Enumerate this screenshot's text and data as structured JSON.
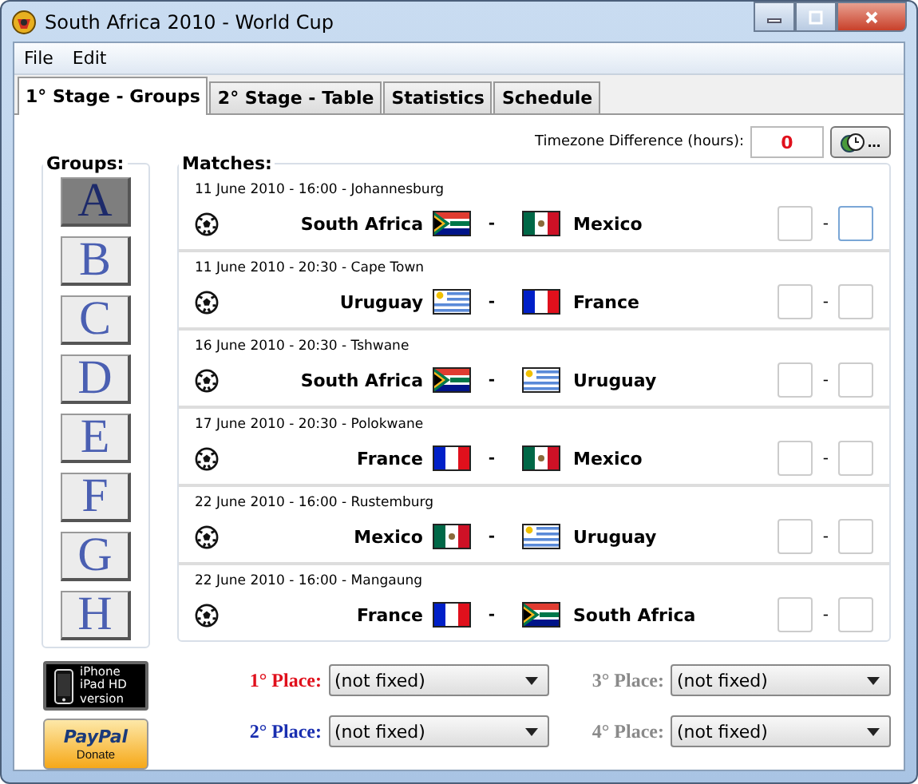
{
  "window": {
    "title": "South Africa 2010 - World Cup"
  },
  "menu": [
    "File",
    "Edit"
  ],
  "tabs": [
    {
      "label": "1° Stage - Groups",
      "selected": true
    },
    {
      "label": "2° Stage - Table",
      "selected": false
    },
    {
      "label": "Statistics",
      "selected": false
    },
    {
      "label": "Schedule",
      "selected": false
    }
  ],
  "timezone": {
    "label": "Timezone Difference (hours):",
    "value": "0",
    "button": "..."
  },
  "groups": {
    "title": "Groups:",
    "items": [
      {
        "label": "A",
        "selected": true
      },
      {
        "label": "B",
        "selected": false
      },
      {
        "label": "C",
        "selected": false
      },
      {
        "label": "D",
        "selected": false
      },
      {
        "label": "E",
        "selected": false
      },
      {
        "label": "F",
        "selected": false
      },
      {
        "label": "G",
        "selected": false
      },
      {
        "label": "H",
        "selected": false
      }
    ]
  },
  "matches": {
    "title": "Matches:",
    "items": [
      {
        "info": "11 June 2010 - 16:00 - Johannesburg",
        "home": "South Africa",
        "home_flag": {
          "kind": "za"
        },
        "separator": "-",
        "away": "Mexico",
        "away_flag": {
          "kind": "mx"
        },
        "score_separator": "-",
        "score_fields": [
          {
            "focused": false
          },
          {
            "focused": true
          }
        ]
      },
      {
        "info": "11 June 2010 - 20:30 - Cape Town",
        "home": "Uruguay",
        "home_flag": {
          "kind": "uy"
        },
        "separator": "-",
        "away": "France",
        "away_flag": {
          "kind": "fr"
        },
        "score_separator": "-",
        "score_fields": [
          {
            "focused": false
          },
          {
            "focused": false
          }
        ]
      },
      {
        "info": "16 June 2010 - 20:30 - Tshwane",
        "home": "South Africa",
        "home_flag": {
          "kind": "za"
        },
        "separator": "-",
        "away": "Uruguay",
        "away_flag": {
          "kind": "uy"
        },
        "score_separator": "-",
        "score_fields": [
          {
            "focused": false
          },
          {
            "focused": false
          }
        ]
      },
      {
        "info": "17 June 2010 - 20:30 - Polokwane",
        "home": "France",
        "home_flag": {
          "kind": "fr"
        },
        "separator": "-",
        "away": "Mexico",
        "away_flag": {
          "kind": "mx"
        },
        "score_separator": "-",
        "score_fields": [
          {
            "focused": false
          },
          {
            "focused": false
          }
        ]
      },
      {
        "info": "22 June 2010 - 16:00 - Rustemburg",
        "home": "Mexico",
        "home_flag": {
          "kind": "mx"
        },
        "separator": "-",
        "away": "Uruguay",
        "away_flag": {
          "kind": "uy"
        },
        "score_separator": "-",
        "score_fields": [
          {
            "focused": false
          },
          {
            "focused": false
          }
        ]
      },
      {
        "info": "22 June 2010 - 16:00 - Mangaung",
        "home": "France",
        "home_flag": {
          "kind": "fr"
        },
        "separator": "-",
        "away": "South Africa",
        "away_flag": {
          "kind": "za"
        },
        "score_separator": "-",
        "score_fields": [
          {
            "focused": false
          },
          {
            "focused": false
          }
        ]
      }
    ]
  },
  "iphone_badge": {
    "lines": [
      "iPhone",
      "iPad HD",
      "version"
    ]
  },
  "paypal": {
    "brand": "PayPal",
    "label": "Donate"
  },
  "places": [
    {
      "label": "1° Place:",
      "value": "(not fixed)",
      "color": "#e0101c"
    },
    {
      "label": "3° Place:",
      "value": "(not fixed)",
      "color": "#8a8a8a"
    },
    {
      "label": "2° Place:",
      "value": "(not fixed)",
      "color": "#1a2fb0"
    },
    {
      "label": "4° Place:",
      "value": "(not fixed)",
      "color": "#8a8a8a"
    }
  ]
}
